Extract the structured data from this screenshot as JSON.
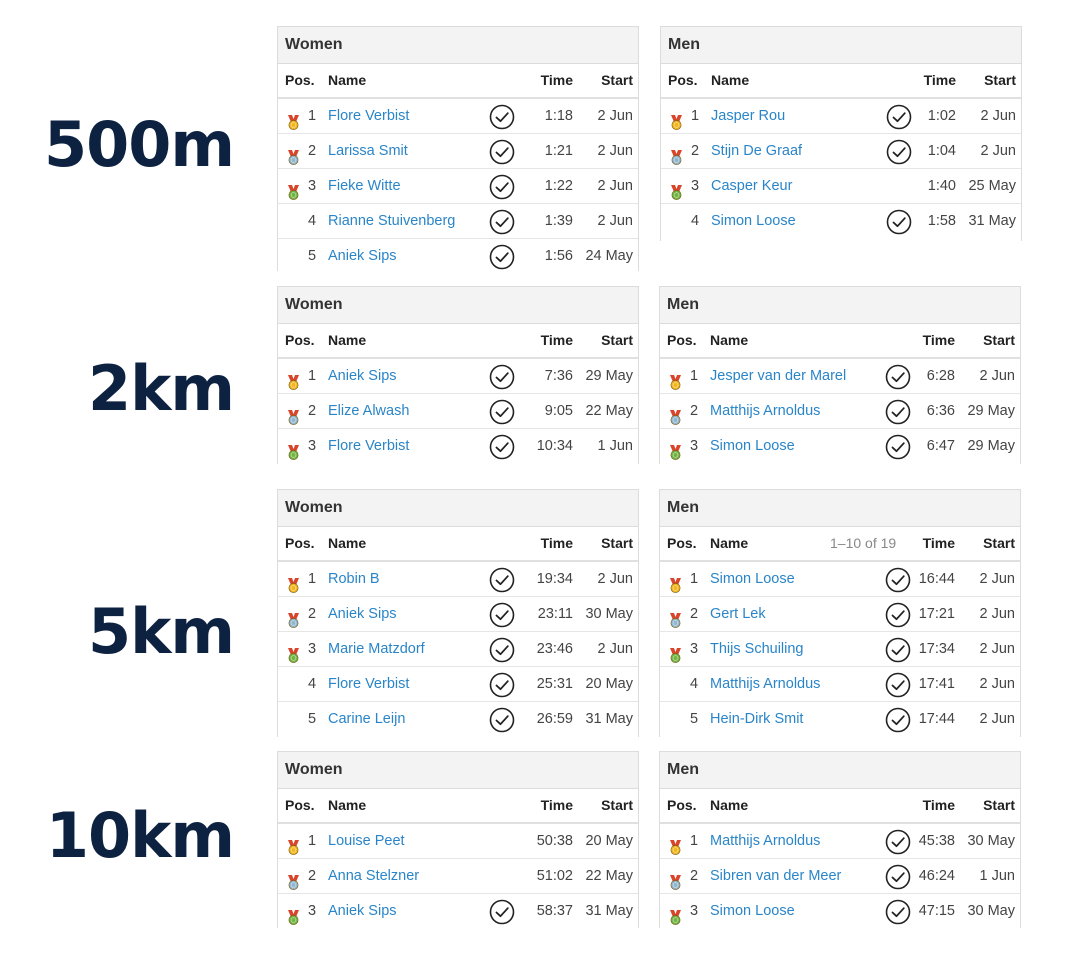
{
  "header_labels": {
    "pos": "Pos.",
    "name": "Name",
    "time": "Time",
    "start": "Start"
  },
  "sections": [
    {
      "distance": "500m",
      "women": {
        "title": "Women",
        "range": "",
        "rows": [
          {
            "pos": "1",
            "medal": "gold",
            "name": "Flore Verbist",
            "check": true,
            "time": "1:18",
            "start": "2 Jun"
          },
          {
            "pos": "2",
            "medal": "silver",
            "name": "Larissa Smit",
            "check": true,
            "time": "1:21",
            "start": "2 Jun"
          },
          {
            "pos": "3",
            "medal": "bronze",
            "name": "Fieke Witte",
            "check": true,
            "time": "1:22",
            "start": "2 Jun"
          },
          {
            "pos": "4",
            "medal": "",
            "name": "Rianne Stuivenberg",
            "check": true,
            "time": "1:39",
            "start": "2 Jun"
          },
          {
            "pos": "5",
            "medal": "",
            "name": "Aniek Sips",
            "check": true,
            "time": "1:56",
            "start": "24 May"
          }
        ]
      },
      "men": {
        "title": "Men",
        "range": "",
        "rows": [
          {
            "pos": "1",
            "medal": "gold",
            "name": "Jasper Rou",
            "check": true,
            "time": "1:02",
            "start": "2 Jun"
          },
          {
            "pos": "2",
            "medal": "silver",
            "name": "Stijn De Graaf",
            "check": true,
            "time": "1:04",
            "start": "2 Jun"
          },
          {
            "pos": "3",
            "medal": "bronze",
            "name": "Casper Keur",
            "check": false,
            "time": "1:40",
            "start": "25 May"
          },
          {
            "pos": "4",
            "medal": "",
            "name": "Simon Loose",
            "check": true,
            "time": "1:58",
            "start": "31 May"
          }
        ]
      }
    },
    {
      "distance": "2km",
      "women": {
        "title": "Women",
        "range": "",
        "rows": [
          {
            "pos": "1",
            "medal": "gold",
            "name": "Aniek Sips",
            "check": true,
            "time": "7:36",
            "start": "29 May"
          },
          {
            "pos": "2",
            "medal": "silver",
            "name": "Elize Alwash",
            "check": true,
            "time": "9:05",
            "start": "22 May"
          },
          {
            "pos": "3",
            "medal": "bronze",
            "name": "Flore Verbist",
            "check": true,
            "time": "10:34",
            "start": "1 Jun"
          }
        ]
      },
      "men": {
        "title": "Men",
        "range": "",
        "rows": [
          {
            "pos": "1",
            "medal": "gold",
            "name": "Jesper van der Marel",
            "check": true,
            "time": "6:28",
            "start": "2 Jun"
          },
          {
            "pos": "2",
            "medal": "silver",
            "name": "Matthijs Arnoldus",
            "check": true,
            "time": "6:36",
            "start": "29 May"
          },
          {
            "pos": "3",
            "medal": "bronze",
            "name": "Simon Loose",
            "check": true,
            "time": "6:47",
            "start": "29 May"
          }
        ]
      }
    },
    {
      "distance": "5km",
      "women": {
        "title": "Women",
        "range": "",
        "rows": [
          {
            "pos": "1",
            "medal": "gold",
            "name": "Robin B",
            "check": true,
            "time": "19:34",
            "start": "2 Jun"
          },
          {
            "pos": "2",
            "medal": "silver",
            "name": "Aniek Sips",
            "check": true,
            "time": "23:11",
            "start": "30 May"
          },
          {
            "pos": "3",
            "medal": "bronze",
            "name": "Marie Matzdorf",
            "check": true,
            "time": "23:46",
            "start": "2 Jun"
          },
          {
            "pos": "4",
            "medal": "",
            "name": "Flore Verbist",
            "check": true,
            "time": "25:31",
            "start": "20 May"
          },
          {
            "pos": "5",
            "medal": "",
            "name": "Carine Leijn",
            "check": true,
            "time": "26:59",
            "start": "31 May"
          }
        ]
      },
      "men": {
        "title": "Men",
        "range": "1–10 of 19",
        "rows": [
          {
            "pos": "1",
            "medal": "gold",
            "name": "Simon Loose",
            "check": true,
            "time": "16:44",
            "start": "2 Jun"
          },
          {
            "pos": "2",
            "medal": "silver",
            "name": "Gert Lek",
            "check": true,
            "time": "17:21",
            "start": "2 Jun"
          },
          {
            "pos": "3",
            "medal": "bronze",
            "name": "Thijs Schuiling",
            "check": true,
            "time": "17:34",
            "start": "2 Jun"
          },
          {
            "pos": "4",
            "medal": "",
            "name": "Matthijs Arnoldus",
            "check": true,
            "time": "17:41",
            "start": "2 Jun"
          },
          {
            "pos": "5",
            "medal": "",
            "name": "Hein-Dirk Smit",
            "check": true,
            "time": "17:44",
            "start": "2 Jun"
          }
        ]
      }
    },
    {
      "distance": "10km",
      "women": {
        "title": "Women",
        "range": "",
        "rows": [
          {
            "pos": "1",
            "medal": "gold",
            "name": "Louise Peet",
            "check": false,
            "time": "50:38",
            "start": "20 May"
          },
          {
            "pos": "2",
            "medal": "silver",
            "name": "Anna Stelzner",
            "check": false,
            "time": "51:02",
            "start": "22 May"
          },
          {
            "pos": "3",
            "medal": "bronze",
            "name": "Aniek Sips",
            "check": true,
            "time": "58:37",
            "start": "31 May"
          }
        ]
      },
      "men": {
        "title": "Men",
        "range": "",
        "rows": [
          {
            "pos": "1",
            "medal": "gold",
            "name": "Matthijs Arnoldus",
            "check": true,
            "time": "45:38",
            "start": "30 May"
          },
          {
            "pos": "2",
            "medal": "silver",
            "name": "Sibren van der Meer",
            "check": true,
            "time": "46:24",
            "start": "1 Jun"
          },
          {
            "pos": "3",
            "medal": "bronze",
            "name": "Simon Loose",
            "check": true,
            "time": "47:15",
            "start": "30 May"
          }
        ]
      }
    }
  ],
  "colors": {
    "distance_text": "#0d2140",
    "link": "#2a85c8",
    "medal_gold": "#f2b51c",
    "medal_silver": "#8fb6cf",
    "medal_bronze": "#6fb542",
    "ribbon": "#d8452b"
  }
}
